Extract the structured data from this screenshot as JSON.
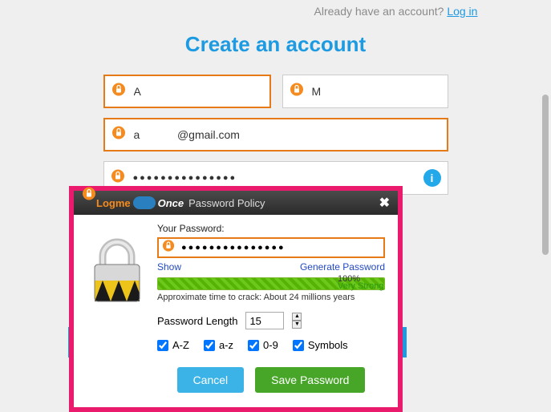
{
  "header": {
    "hint_prefix": "Already have an account? ",
    "login_link": "Log in"
  },
  "page_title": "Create an account",
  "form": {
    "first_name": "A",
    "last_name": "M",
    "email": "a            @gmail.com",
    "password_mask": "●●●●●●●●●●●●●●●"
  },
  "modal": {
    "brand_part1": "Logme",
    "brand_part2": "Once",
    "title": "Password Policy",
    "label_your_password": "Your Password:",
    "password_value": "●●●●●●●●●●●●●●●",
    "show": "Show",
    "generate": "Generate Password",
    "strength_percent": "100%",
    "strength_text": "Very Strong",
    "crack_time": "Approximate time to crack: About 24 millions years",
    "length_label": "Password Length",
    "length_value": "15",
    "chk_upper": "A-Z",
    "chk_lower": "a-z",
    "chk_digits": "0-9",
    "chk_symbols": "Symbols",
    "cancel": "Cancel",
    "save": "Save Password"
  }
}
